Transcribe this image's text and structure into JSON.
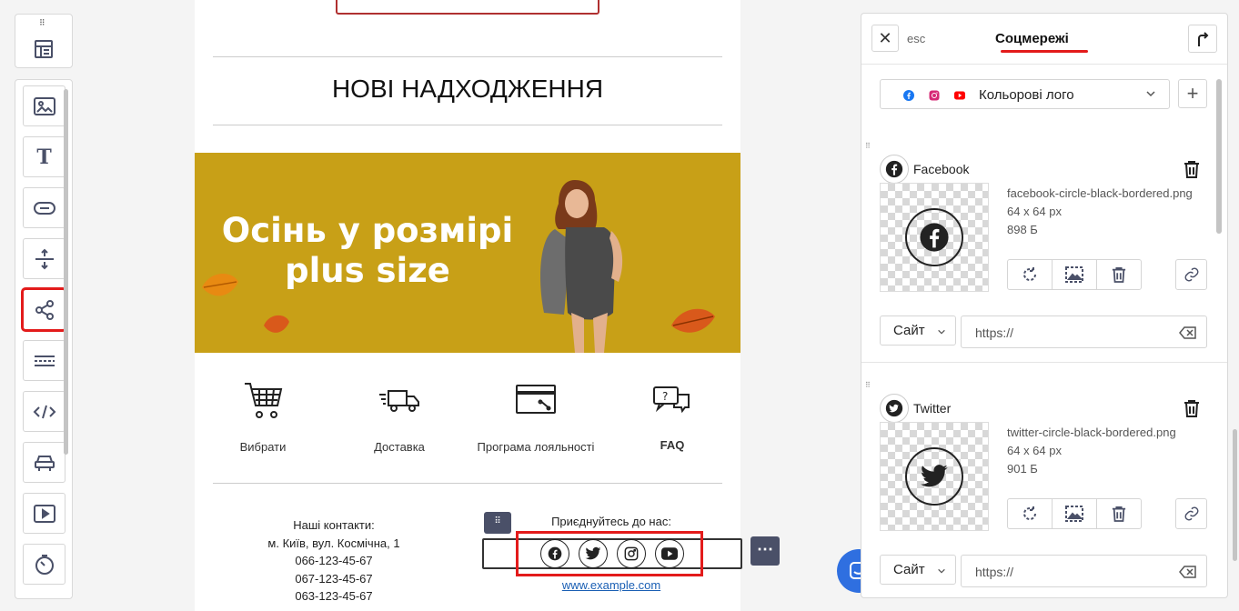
{
  "toolbar": {
    "items": [
      "layout-block",
      "image",
      "text",
      "button",
      "spacer",
      "social",
      "divider",
      "html",
      "menu",
      "video",
      "timer"
    ],
    "active": "social"
  },
  "email": {
    "heading": "НОВІ НАДХОДЖЕННЯ",
    "banner_line1": "Осінь у розмірі",
    "banner_line2": "plus size",
    "features": [
      {
        "label": "Вибрати"
      },
      {
        "label": "Доставка"
      },
      {
        "label": "Програма лояльності"
      },
      {
        "label": "FAQ"
      }
    ],
    "contacts_title": "Наші контакти:",
    "contacts_address": "м. Київ, вул. Космічна, 1",
    "phones": [
      "066-123-45-67",
      "067-123-45-67",
      "063-123-45-67"
    ],
    "join_title": "Приєднуйтесь до нас:",
    "link": "www.example.com",
    "social_icons": [
      "facebook-icon",
      "twitter-icon",
      "instagram-icon",
      "youtube-icon"
    ]
  },
  "panel": {
    "close_label": "✕",
    "esc_label": "esc",
    "title": "Соцмережі",
    "style_select": "Кольорові лого",
    "add_label": "+",
    "networks": [
      {
        "name": "Facebook",
        "file": "facebook-circle-black-bordered.png",
        "dims": "64 x 64 px",
        "size": "898 Б",
        "link_type": "Сайт",
        "url_placeholder": "https://"
      },
      {
        "name": "Twitter",
        "file": "twitter-circle-black-bordered.png",
        "dims": "64 x 64 px",
        "size": "901 Б",
        "link_type": "Сайт",
        "url_placeholder": "https://"
      }
    ]
  },
  "colors": {
    "accent_red": "#e31b1b",
    "banner_bg": "#c8a017",
    "tool_dark": "#4a5068",
    "chat_blue": "#2f6fe0"
  }
}
